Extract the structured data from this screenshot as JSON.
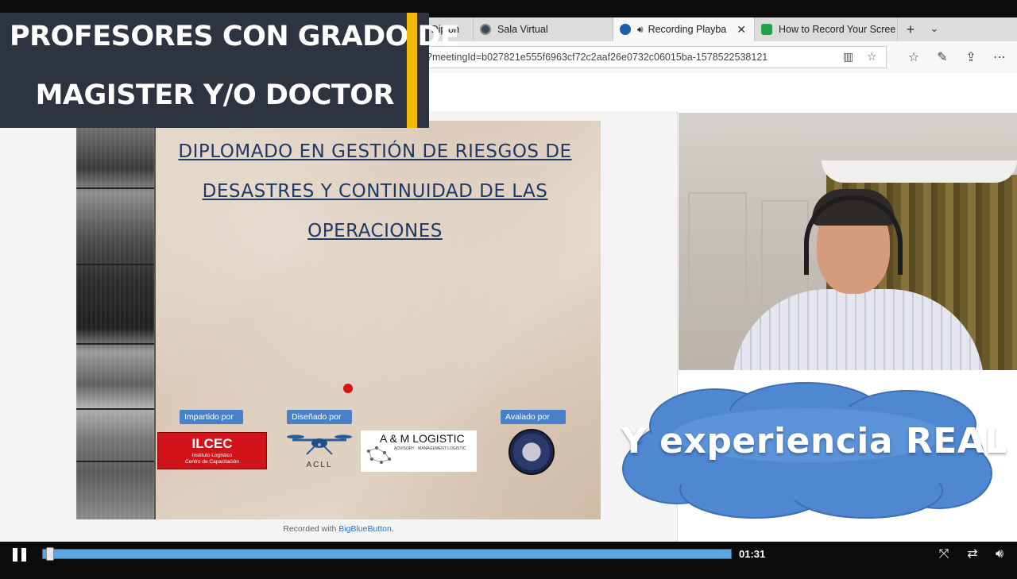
{
  "browser": {
    "tabs": [
      {
        "label": "ra Diplon",
        "active": false
      },
      {
        "label": "Sala Virtual",
        "active": false
      },
      {
        "label": "Recording Playba",
        "active": true
      },
      {
        "label": "How to Record Your Scree",
        "active": false
      }
    ],
    "url": "?meetingId=b027821e555f6963cf72c2aaf26e0732c06015ba-1578522538121"
  },
  "banner": {
    "line1": "PROFESORES CON GRADO DE",
    "line2": "MAGISTER Y/O DOCTOR"
  },
  "slide": {
    "title_lines": [
      "DIPLOMADO EN GESTIÓN DE RIESGOS DE",
      "DESASTRES Y CONTINUIDAD DE LAS",
      "OPERACIONES"
    ],
    "labels": {
      "impartido": "Impartido por",
      "disenado": "Diseñado por",
      "avalado": "Avalado por"
    },
    "logos": {
      "ilcec_name": "ILCEC",
      "ilcec_sub1": "Instituto Logístico",
      "ilcec_sub2": "Centro de Capacitación",
      "acll": "ACLL",
      "am_name": "A & M LOGISTIC",
      "am_sub": "ADVISORY · MANAGEMENT LOGISTIC"
    }
  },
  "recorded": {
    "prefix": "Recorded with ",
    "brand": "BigBlueButton",
    "suffix": "."
  },
  "cloud_text": "Y experiencia REAL",
  "player": {
    "time": "01:31",
    "progress_fraction": 0.01
  },
  "colors": {
    "banner_bg": "#2e3340",
    "banner_accent": "#f2b80c",
    "cloud": "#4f87d0",
    "progress": "#5ea6dd",
    "slide_title": "#1f3864"
  }
}
